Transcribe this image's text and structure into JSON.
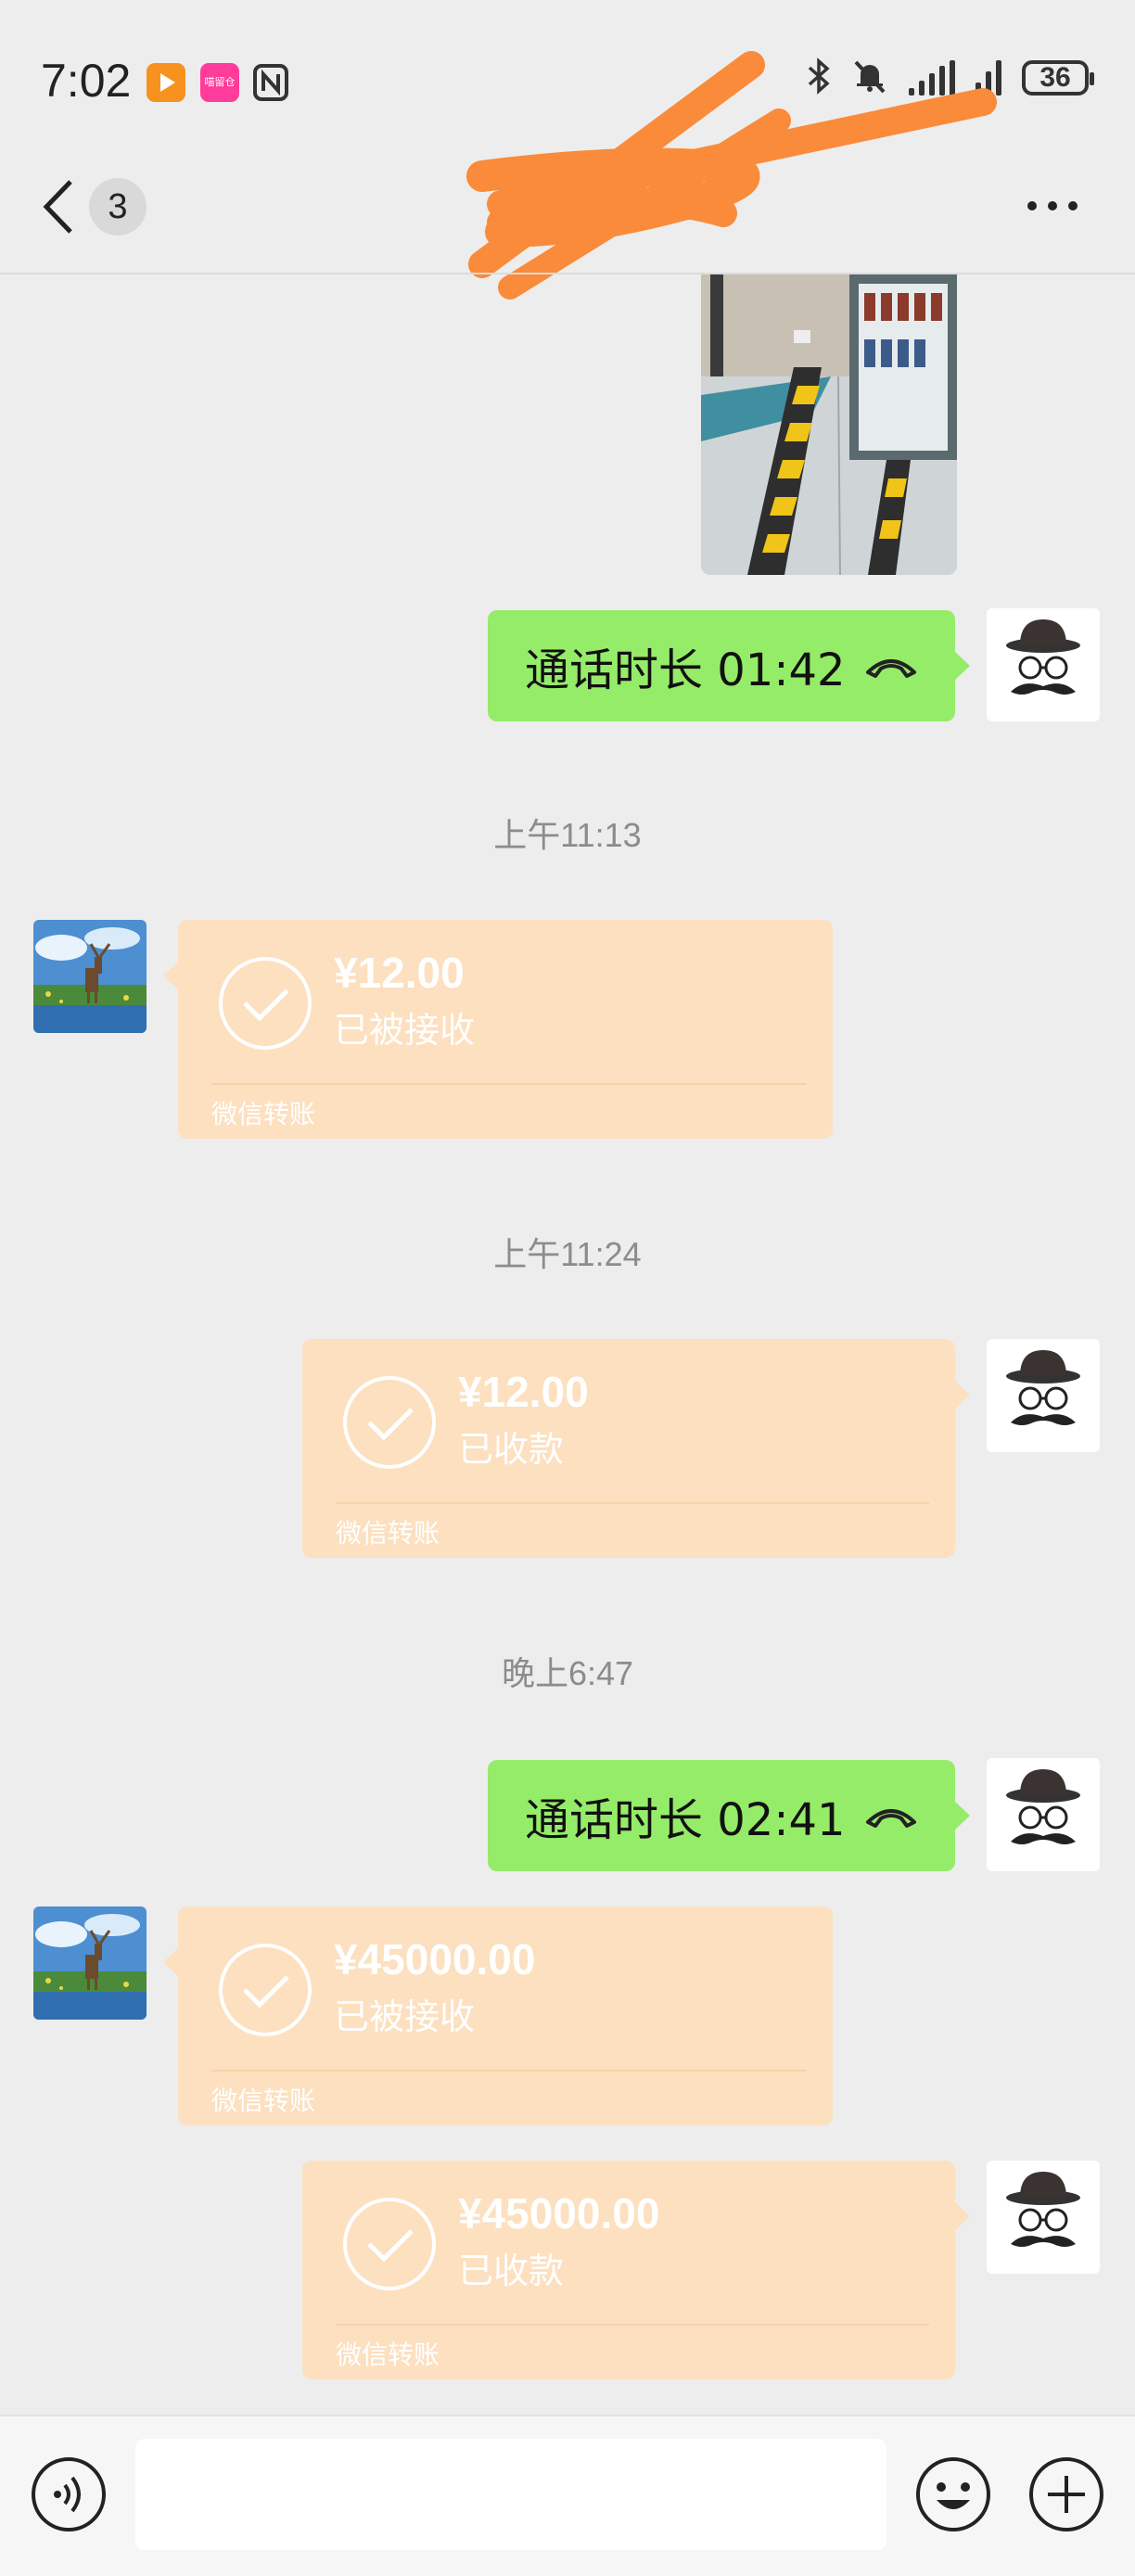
{
  "status_bar": {
    "time": "7:02",
    "battery": "36",
    "app_icon_label": "喵留仓"
  },
  "header": {
    "unread_count": "3"
  },
  "messages": {
    "call1": {
      "text": "通话时长 01:42"
    },
    "ts1": "上午11:13",
    "transfer1": {
      "amount": "¥12.00",
      "status": "已被接收",
      "label": "微信转账"
    },
    "ts2": "上午11:24",
    "transfer2": {
      "amount": "¥12.00",
      "status": "已收款",
      "label": "微信转账"
    },
    "ts3": "晚上6:47",
    "call2": {
      "text": "通话时长 02:41"
    },
    "transfer3": {
      "amount": "¥45000.00",
      "status": "已被接收",
      "label": "微信转账"
    },
    "transfer4": {
      "amount": "¥45000.00",
      "status": "已收款",
      "label": "微信转账"
    }
  },
  "icons": {
    "back": "chevron-left-icon",
    "more": "more-icon",
    "voice": "voice-icon",
    "emoji": "emoji-icon",
    "plus": "plus-icon",
    "phone": "phone-hangup-icon",
    "check": "check-circle-icon"
  },
  "colors": {
    "background": "#ededed",
    "call_bubble": "#95ec69",
    "transfer_bubble": "#fce0c0",
    "scribble": "#f98b3a"
  }
}
